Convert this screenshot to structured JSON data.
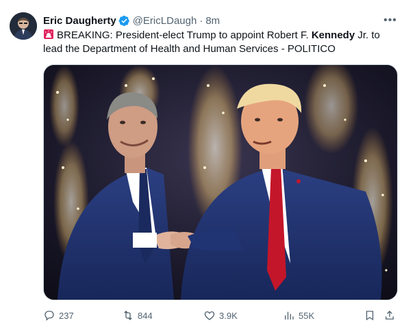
{
  "author": {
    "display_name": "Eric Daugherty",
    "handle": "@EricLDaugh",
    "separator": "·",
    "time": "8m"
  },
  "more_label": "•••",
  "tweet": {
    "prefix": "BREAKING: President-elect Trump to appoint Robert F. ",
    "bold": "Kennedy",
    "suffix": " Jr. to lead the Department of Health and Human Services - POLITICO"
  },
  "media": {
    "description": "photo"
  },
  "stats": {
    "replies": "237",
    "reposts": "844",
    "likes": "3.9K",
    "views": "55K"
  },
  "icons": {
    "verified": "verified-badge-icon",
    "siren": "rotating-light-icon",
    "reply": "reply-icon",
    "repost": "repost-icon",
    "like": "heart-icon",
    "views": "views-icon",
    "bookmark": "bookmark-icon",
    "share": "share-icon"
  },
  "colors": {
    "verified_blue": "#1d9bf0",
    "text": "#0f1419",
    "muted": "#536471"
  }
}
